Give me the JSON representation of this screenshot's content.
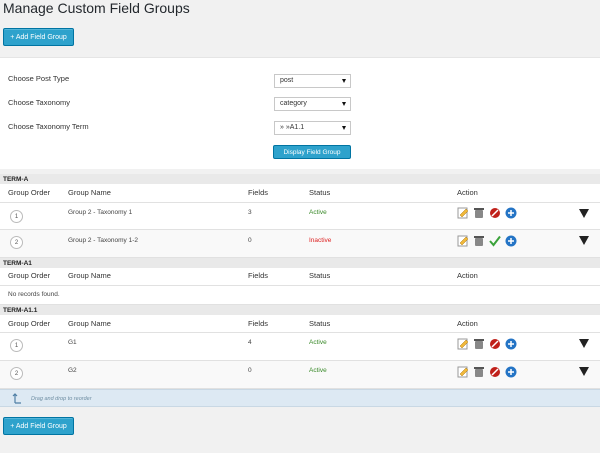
{
  "page": {
    "title": "Manage Custom Field Groups",
    "add_button_label": "+ Add Field Group"
  },
  "filters": {
    "post_type": {
      "label": "Choose Post Type",
      "value": "post"
    },
    "taxonomy": {
      "label": "Choose Taxonomy",
      "value": "category"
    },
    "taxonomy_term": {
      "label": "Choose Taxonomy Term",
      "value": "» »A1.1"
    },
    "display_button_label": "Display Field Group"
  },
  "columns": {
    "order": "Group Order",
    "name": "Group Name",
    "fields": "Fields",
    "status": "Status",
    "action": "Action"
  },
  "groups": [
    {
      "title": "TERM-A",
      "rows": [
        {
          "order": "1",
          "name": "Group 2 - Taxonomy 1",
          "fields": "3",
          "status": "Active"
        },
        {
          "order": "2",
          "name": "Group 2 - Taxonomy 1-2",
          "fields": "0",
          "status": "Inactive"
        }
      ]
    },
    {
      "title": "TERM-A1",
      "empty_text": "No records found."
    },
    {
      "title": "TERM-A1.1",
      "rows": [
        {
          "order": "1",
          "name": "G1",
          "fields": "4",
          "status": "Active"
        },
        {
          "order": "2",
          "name": "G2",
          "fields": "0",
          "status": "Active"
        }
      ]
    }
  ],
  "drag_hint": "Drag and drop to reorder",
  "colors": {
    "accent": "#2ea2cc",
    "active": "#3a8a2a",
    "inactive": "#dd2222"
  }
}
